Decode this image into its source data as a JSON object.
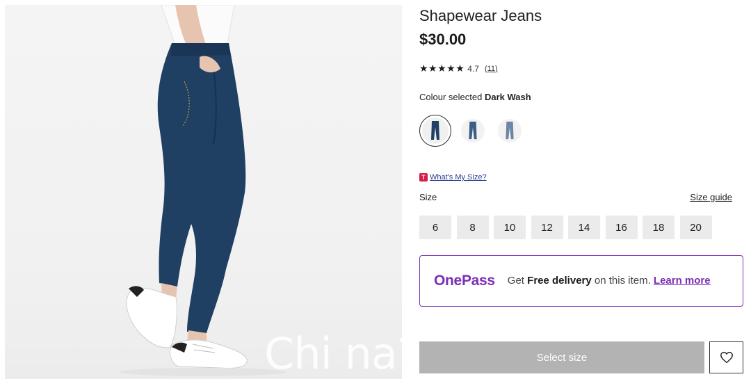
{
  "product": {
    "title": "Shapewear Jeans",
    "price": "$30.00",
    "rating": {
      "stars": "★★★★★",
      "value": "4.7",
      "count": "(11)"
    }
  },
  "colour": {
    "label": "Colour selected",
    "selected": "Dark Wash",
    "swatches": [
      "dark-wash",
      "mid-wash",
      "light-wash"
    ]
  },
  "size": {
    "whats_my_size_badge": "T",
    "whats_my_size_link": "What's My Size?",
    "label": "Size",
    "guide_link": "Size guide",
    "options": [
      "6",
      "8",
      "10",
      "12",
      "14",
      "16",
      "18",
      "20"
    ]
  },
  "onepass": {
    "logo": "OnePass",
    "text_before": "Get ",
    "text_bold": "Free delivery",
    "text_after": " on this item. ",
    "learn_more": "Learn more"
  },
  "actions": {
    "select_size": "Select size",
    "wishlist_icon": "heart-icon"
  },
  "watermark": "Chi na?au",
  "colors": {
    "onepass_purple": "#7b2fb5",
    "select_button_gray": "#b3b3b3",
    "size_button_bg": "#ebebeb",
    "badge_red": "#d81b4a",
    "denim": "#1f3f63"
  }
}
